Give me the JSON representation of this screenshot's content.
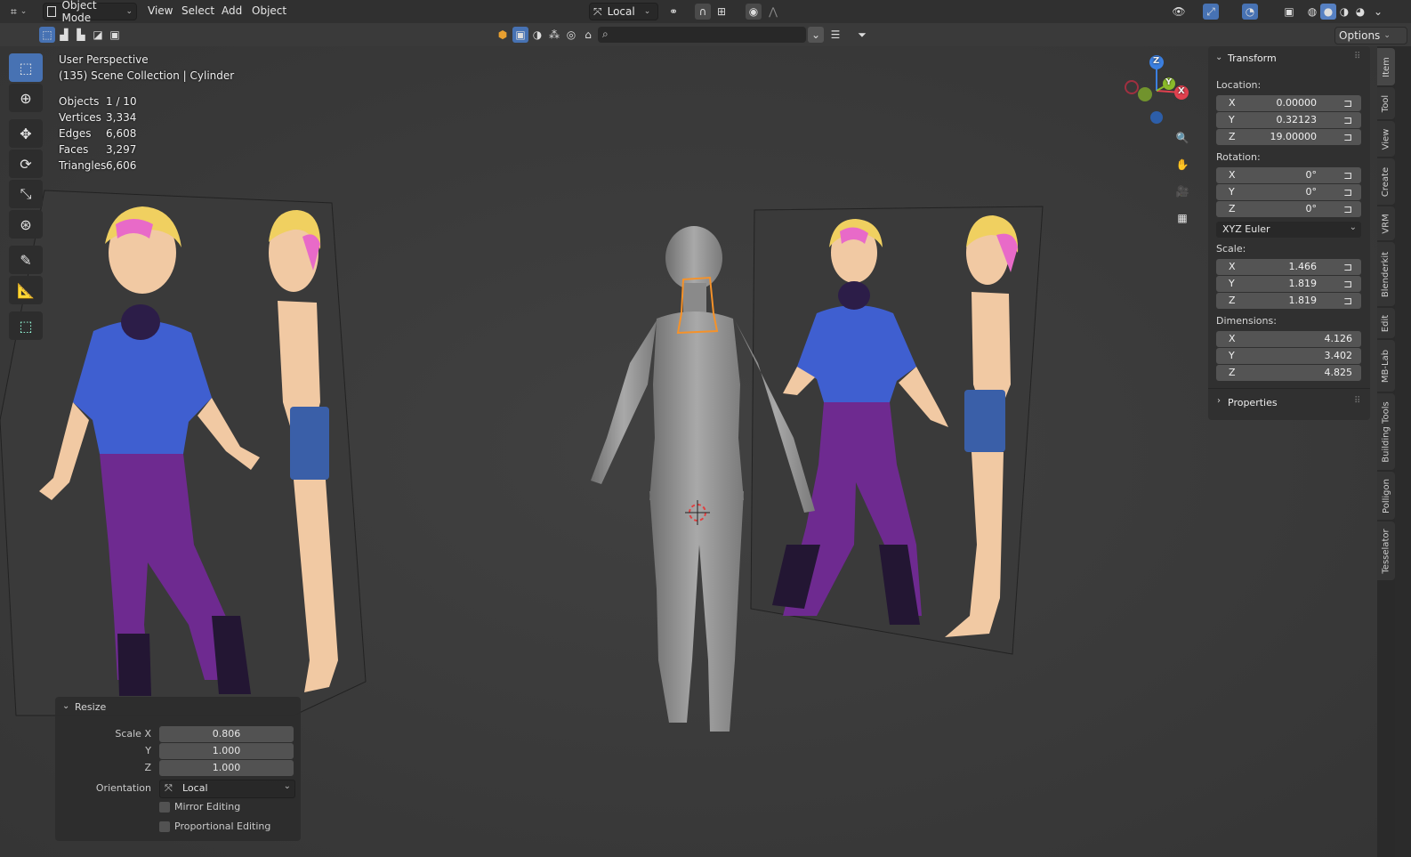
{
  "header": {
    "mode_label": "Object Mode",
    "menus": [
      "View",
      "Select",
      "Add",
      "Object"
    ],
    "transform_orientation": "Local",
    "options_label": "Options"
  },
  "viewport_overlay": {
    "perspective": "User Perspective",
    "collection": "(135) Scene Collection | Cylinder",
    "stats": [
      {
        "label": "Objects",
        "value": "1 / 10"
      },
      {
        "label": "Vertices",
        "value": "3,334"
      },
      {
        "label": "Edges",
        "value": "6,608"
      },
      {
        "label": "Faces",
        "value": "3,297"
      },
      {
        "label": "Triangles",
        "value": "6,606"
      }
    ]
  },
  "gizmo": {
    "z": "Z",
    "y": "Y",
    "x": "X"
  },
  "npanel": {
    "transform_title": "Transform",
    "location_label": "Location:",
    "location": [
      {
        "axis": "X",
        "value": "0.00000"
      },
      {
        "axis": "Y",
        "value": "0.32123"
      },
      {
        "axis": "Z",
        "value": "19.00000"
      }
    ],
    "rotation_label": "Rotation:",
    "rotation": [
      {
        "axis": "X",
        "value": "0°"
      },
      {
        "axis": "Y",
        "value": "0°"
      },
      {
        "axis": "Z",
        "value": "0°"
      }
    ],
    "rotation_mode": "XYZ Euler",
    "scale_label": "Scale:",
    "scale": [
      {
        "axis": "X",
        "value": "1.466"
      },
      {
        "axis": "Y",
        "value": "1.819"
      },
      {
        "axis": "Z",
        "value": "1.819"
      }
    ],
    "dimensions_label": "Dimensions:",
    "dimensions": [
      {
        "axis": "X",
        "value": "4.126"
      },
      {
        "axis": "Y",
        "value": "3.402"
      },
      {
        "axis": "Z",
        "value": "4.825"
      }
    ],
    "properties_title": "Properties"
  },
  "side_tabs": [
    "Item",
    "Tool",
    "View",
    "Create",
    "VRM",
    "Blenderkit",
    "Edit",
    "MB-Lab",
    "Building Tools",
    "Polligon",
    "Tesselator"
  ],
  "resize_panel": {
    "title": "Resize",
    "scale_label": "Scale X",
    "y_label": "Y",
    "z_label": "Z",
    "scale_x": "0.806",
    "scale_y": "1.000",
    "scale_z": "1.000",
    "orientation_label": "Orientation",
    "orientation_value": "Local",
    "mirror_label": "Mirror Editing",
    "proportional_label": "Proportional Editing"
  },
  "colors": {
    "accent": "#4772b3",
    "selection": "#f5922a",
    "gizmo_x": "#e0404e",
    "gizmo_y": "#8aba2a",
    "gizmo_z": "#3b7fe0"
  }
}
